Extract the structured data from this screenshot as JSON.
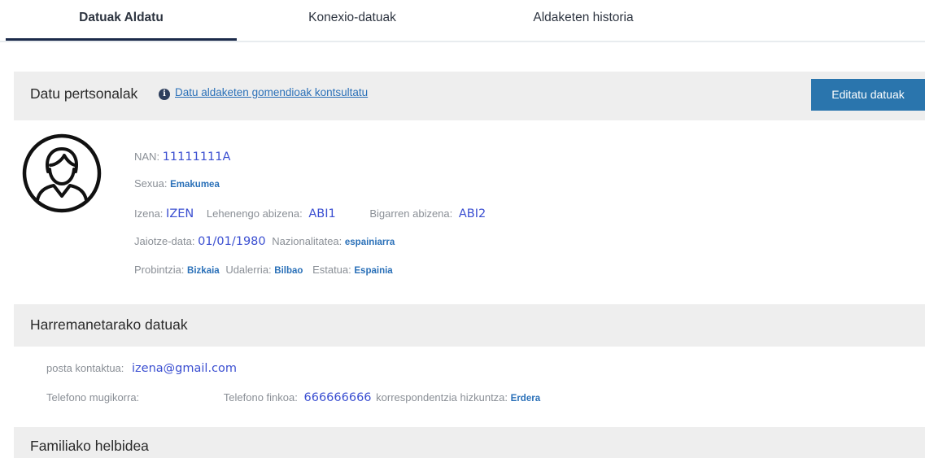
{
  "tabs": [
    {
      "label": "Datuak Aldatu",
      "active": true
    },
    {
      "label": "Konexio-datuak",
      "active": false
    },
    {
      "label": "Aldaketen historia",
      "active": false
    }
  ],
  "personal": {
    "title": "Datu pertsonalak",
    "info_icon": "info-circle-icon",
    "consult_link": "Datu aldaketen gomendioak kontsultatu",
    "edit_button": "Editatu datuak",
    "avatar_icon": "user-avatar-icon",
    "nan_label": "NAN:",
    "nan_value": "11111111A",
    "sexua_label": "Sexua:",
    "sexua_value": "Emakumea",
    "izena_label": "Izena:",
    "izena_value": "IZEN",
    "abizena1_label": "Lehenengo abizena:",
    "abizena1_value": "ABI1",
    "abizena2_label": "Bigarren abizena:",
    "abizena2_value": "ABI2",
    "jaiotze_label": "Jaiotze-data:",
    "jaiotze_value": "01/01/1980",
    "nazio_label": "Nazionalitatea:",
    "nazio_value": "espainiarra",
    "probintzia_label": "Probintzia:",
    "probintzia_value": "Bizkaia",
    "udalerria_label": "Udalerria:",
    "udalerria_value": "Bilbao",
    "estatua_label": "Estatua:",
    "estatua_value": "Espainia"
  },
  "contact": {
    "title": "Harremanetarako datuak",
    "posta_label": "posta kontaktua:",
    "posta_value": "izena@gmail.com",
    "mugikorra_label": "Telefono mugikorra:",
    "finkoa_label": "Telefono finkoa:",
    "finkoa_value": "666666666",
    "hizkuntza_label": "korrespondentzia hizkuntza:",
    "hizkuntza_value": "Erdera"
  },
  "family": {
    "title": "Familiako helbidea"
  },
  "colors": {
    "accent": "#2a75ad",
    "value_blue": "#3b4fd1",
    "link_blue": "#2a70b8",
    "tab_underline": "#1b2a4a",
    "bar_bg": "#eeeeee"
  }
}
